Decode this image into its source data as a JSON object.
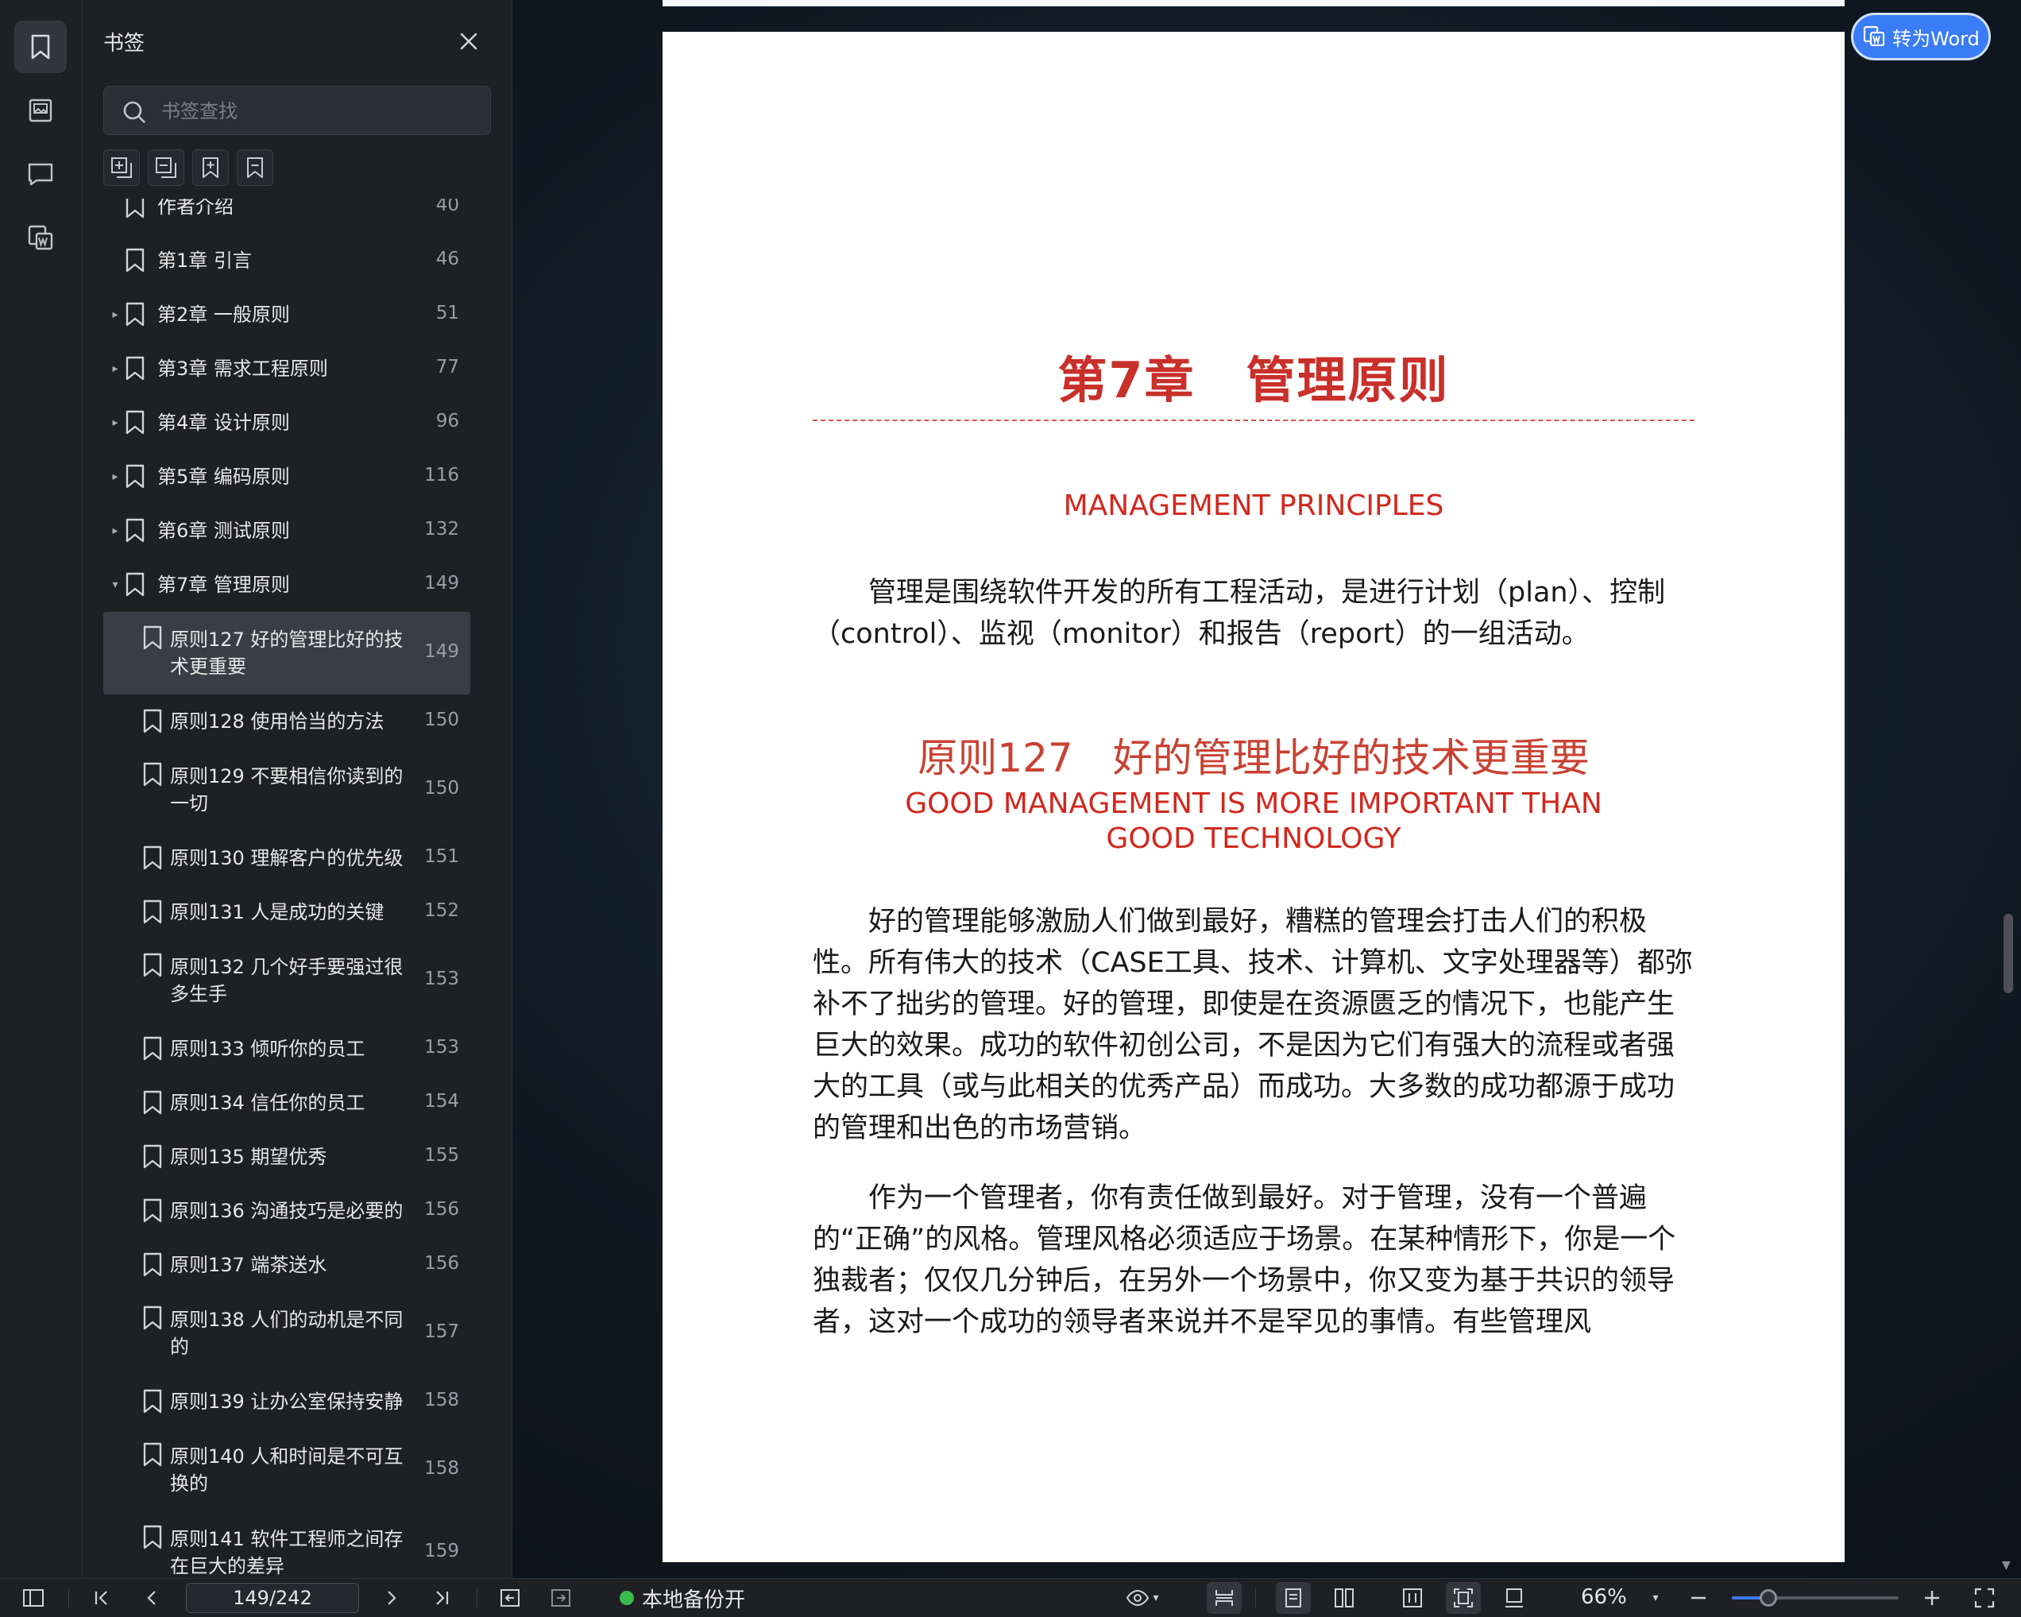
{
  "panel": {
    "title": "书签",
    "search_placeholder": "书签查找"
  },
  "bookmarks": [
    {
      "label": "作者介绍",
      "page": "40",
      "level": 0,
      "arrow": ""
    },
    {
      "label": "第1章 引言",
      "page": "46",
      "level": 0,
      "arrow": ""
    },
    {
      "label": "第2章 一般原则",
      "page": "51",
      "level": 0,
      "arrow": "▸"
    },
    {
      "label": "第3章 需求工程原则",
      "page": "77",
      "level": 0,
      "arrow": "▸"
    },
    {
      "label": "第4章 设计原则",
      "page": "96",
      "level": 0,
      "arrow": "▸"
    },
    {
      "label": "第5章 编码原则",
      "page": "116",
      "level": 0,
      "arrow": "▸"
    },
    {
      "label": "第6章 测试原则",
      "page": "132",
      "level": 0,
      "arrow": "▸"
    },
    {
      "label": "第7章 管理原则",
      "page": "149",
      "level": 0,
      "arrow": "▾"
    },
    {
      "label": "原则127 好的管理比好的技\n术更重要",
      "page": "149",
      "level": 1,
      "arrow": "",
      "selected": true
    },
    {
      "label": "原则128 使用恰当的方法",
      "page": "150",
      "level": 1,
      "arrow": ""
    },
    {
      "label": "原则129 不要相信你读到的\n一切",
      "page": "150",
      "level": 1,
      "arrow": ""
    },
    {
      "label": "原则130 理解客户的优先级",
      "page": "151",
      "level": 1,
      "arrow": ""
    },
    {
      "label": "原则131 人是成功的关键",
      "page": "152",
      "level": 1,
      "arrow": ""
    },
    {
      "label": "原则132 几个好手要强过很\n多生手",
      "page": "153",
      "level": 1,
      "arrow": ""
    },
    {
      "label": "原则133 倾听你的员工",
      "page": "153",
      "level": 1,
      "arrow": ""
    },
    {
      "label": "原则134 信任你的员工",
      "page": "154",
      "level": 1,
      "arrow": ""
    },
    {
      "label": "原则135 期望优秀",
      "page": "155",
      "level": 1,
      "arrow": ""
    },
    {
      "label": "原则136 沟通技巧是必要的",
      "page": "156",
      "level": 1,
      "arrow": ""
    },
    {
      "label": "原则137 端茶送水",
      "page": "156",
      "level": 1,
      "arrow": ""
    },
    {
      "label": "原则138 人们的动机是不同\n的",
      "page": "157",
      "level": 1,
      "arrow": ""
    },
    {
      "label": "原则139 让办公室保持安静",
      "page": "158",
      "level": 1,
      "arrow": ""
    },
    {
      "label": "原则140 人和时间是不可互\n换的",
      "page": "158",
      "level": 1,
      "arrow": ""
    },
    {
      "label": "原则141 软件工程师之间存\n在巨大的差异",
      "page": "159",
      "level": 1,
      "arrow": ""
    }
  ],
  "document": {
    "chapter_title": "第7章　管理原则",
    "chapter_subtitle": "MANAGEMENT PRINCIPLES",
    "intro": "管理是围绕软件开发的所有工程活动，是进行计划（plan）、控制（control）、监视（monitor）和报告（report）的一组活动。",
    "principle_title": "原则127　好的管理比好的技术更重要",
    "principle_subtitle": "GOOD MANAGEMENT IS MORE IMPORTANT THAN GOOD TECHNOLOGY",
    "para1": "好的管理能够激励人们做到最好，糟糕的管理会打击人们的积极性。所有伟大的技术（CASE工具、技术、计算机、文字处理器等）都弥补不了拙劣的管理。好的管理，即使是在资源匮乏的情况下，也能产生巨大的效果。成功的软件初创公司，不是因为它们有强大的流程或者强大的工具（或与此相关的优秀产品）而成功。大多数的成功都源于成功的管理和出色的市场营销。",
    "para2": "作为一个管理者，你有责任做到最好。对于管理，没有一个普遍的“正确”的风格。管理风格必须适应于场景。在某种情形下，你是一个独裁者；仅仅几分钟后，在另外一个场景中，你又变为基于共识的领导者，这对一个成功的领导者来说并不是罕见的事情。有些管理风"
  },
  "convert_button": "转为Word",
  "status": {
    "page_indicator": "149/242",
    "backup_label": "本地备份开",
    "zoom": "66%",
    "zoom_fraction": 0.22
  },
  "colors": {
    "accent": "#3a7bf6",
    "heading_red": "#c9302a",
    "backup_dot": "#3bba4e"
  }
}
